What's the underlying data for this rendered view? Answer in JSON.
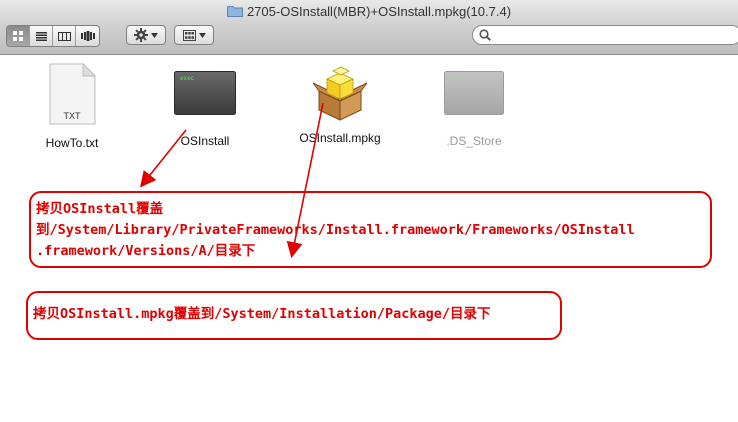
{
  "window": {
    "title": "2705-OSInstall(MBR)+OSInstall.mpkg(10.7.4)"
  },
  "toolbar": {
    "views": [
      "icon-view",
      "list-view",
      "column-view",
      "coverflow-view"
    ],
    "active_view": "icon-view",
    "search": {
      "value": "",
      "placeholder": ""
    }
  },
  "files": [
    {
      "name": "HowTo.txt",
      "badge": "TXT",
      "kind": "text-document-icon",
      "dimmed": false
    },
    {
      "name": "OSInstall",
      "badge": "exec",
      "kind": "unix-executable-icon",
      "dimmed": false
    },
    {
      "name": "OSInstall.mpkg",
      "badge": "",
      "kind": "installer-package-icon",
      "dimmed": false
    },
    {
      "name": ".DS_Store",
      "badge": "exec",
      "kind": "unix-executable-icon",
      "dimmed": true
    }
  ],
  "annotations": {
    "color": "#e00000",
    "callout1": [
      "拷贝OSInstall覆盖",
      "到/System/Library/PrivateFrameworks/Install.framework/Frameworks/OSInstall",
      ".framework/Versions/A/目录下"
    ],
    "callout2": "拷贝OSInstall.mpkg覆盖到/System/Installation/Package/目录下"
  }
}
